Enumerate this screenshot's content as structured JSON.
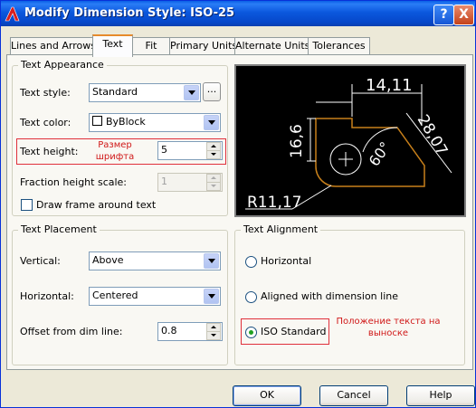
{
  "window": {
    "title": "Modify Dimension Style: ISO-25",
    "help_btn": "?",
    "close_btn": "X"
  },
  "tabs": [
    "Lines and Arrows",
    "Text",
    "Fit",
    "Primary Units",
    "Alternate Units",
    "Tolerances"
  ],
  "text_appearance": {
    "title": "Text Appearance",
    "style_label": "Text style:",
    "style_value": "Standard",
    "ellipsis": "...",
    "color_label": "Text color:",
    "color_value": "ByBlock",
    "height_label": "Text height:",
    "height_value": "5",
    "fraction_label": "Fraction height scale:",
    "fraction_value": "1",
    "frame_label": "Draw frame around text"
  },
  "annotation_height": "Размер шрифта",
  "text_placement": {
    "title": "Text Placement",
    "vertical_label": "Vertical:",
    "vertical_value": "Above",
    "horizontal_label": "Horizontal:",
    "horizontal_value": "Centered",
    "offset_label": "Offset from dim line:",
    "offset_value": "0.8"
  },
  "text_alignment": {
    "title": "Text Alignment",
    "options": [
      "Horizontal",
      "Aligned with dimension line",
      "ISO Standard"
    ],
    "selected": "ISO Standard"
  },
  "annotation_alignment": "Положение текста на выноске",
  "preview": {
    "dim_top": "14,11",
    "dim_left": "16,6",
    "dim_right": "28,07",
    "angle": "60°",
    "radius": "R11,17"
  },
  "buttons": {
    "ok": "OK",
    "cancel": "Cancel",
    "help": "Help"
  },
  "colors": {
    "accent_annotation": "#e0303a",
    "preview_bg": "#000000",
    "preview_lines": "#ffffff",
    "preview_shape": "#c8801a"
  }
}
